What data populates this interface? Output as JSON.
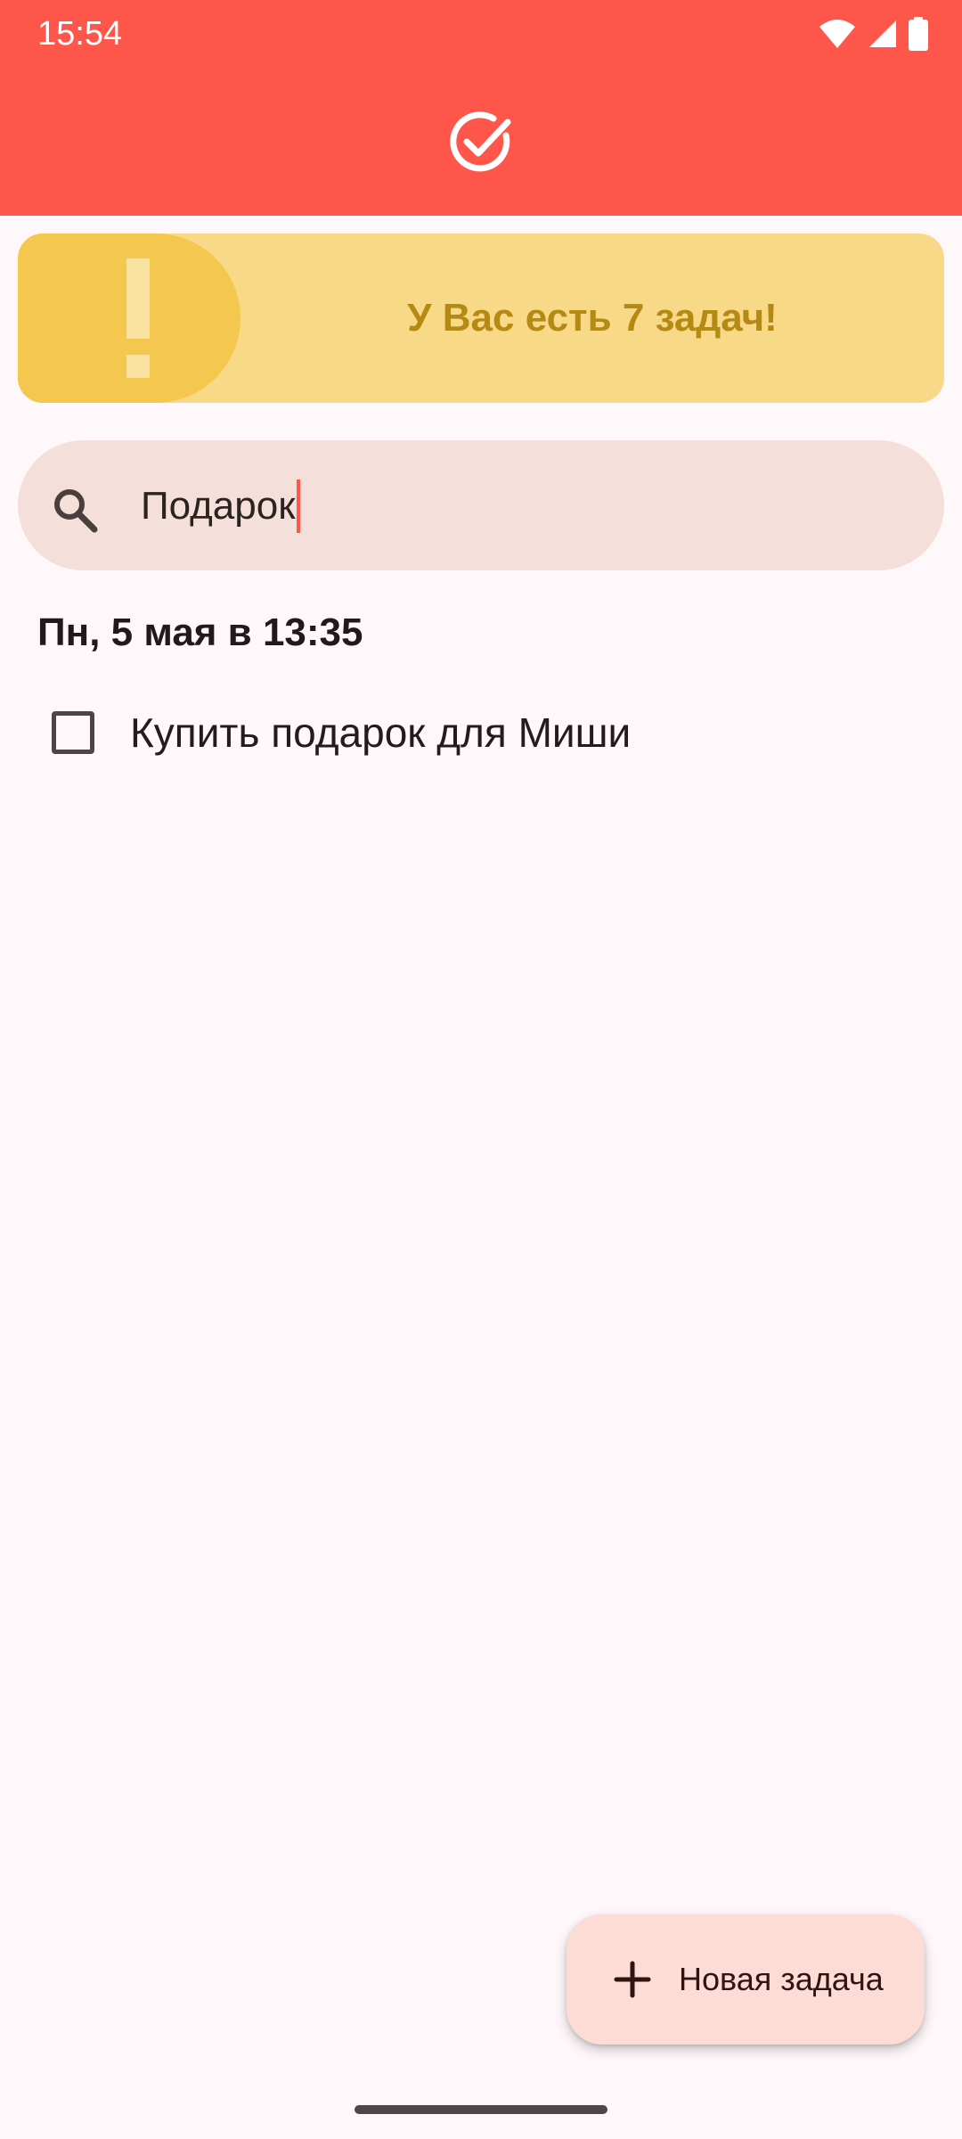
{
  "status_bar": {
    "time": "15:54",
    "icons": [
      "wifi-icon",
      "cellular-signal-icon",
      "battery-icon"
    ]
  },
  "header": {
    "logo_icon": "check-circle-icon",
    "background_color": "#FE564B"
  },
  "alert": {
    "icon": "exclamation-icon",
    "text": "У Вас есть 7 задач!",
    "background_color": "#F8D987",
    "accent_color": "#F4C84E",
    "text_color": "#B58A14"
  },
  "search": {
    "icon": "search-icon",
    "value": "Подарок",
    "placeholder": ""
  },
  "task_groups": [
    {
      "date_label": "Пн, 5 мая в 13:35",
      "tasks": [
        {
          "label": "Купить подарок для Миши",
          "checked": false
        }
      ]
    }
  ],
  "fab": {
    "icon": "plus-icon",
    "label": "Новая задача",
    "background_color": "#FDDCD6"
  }
}
